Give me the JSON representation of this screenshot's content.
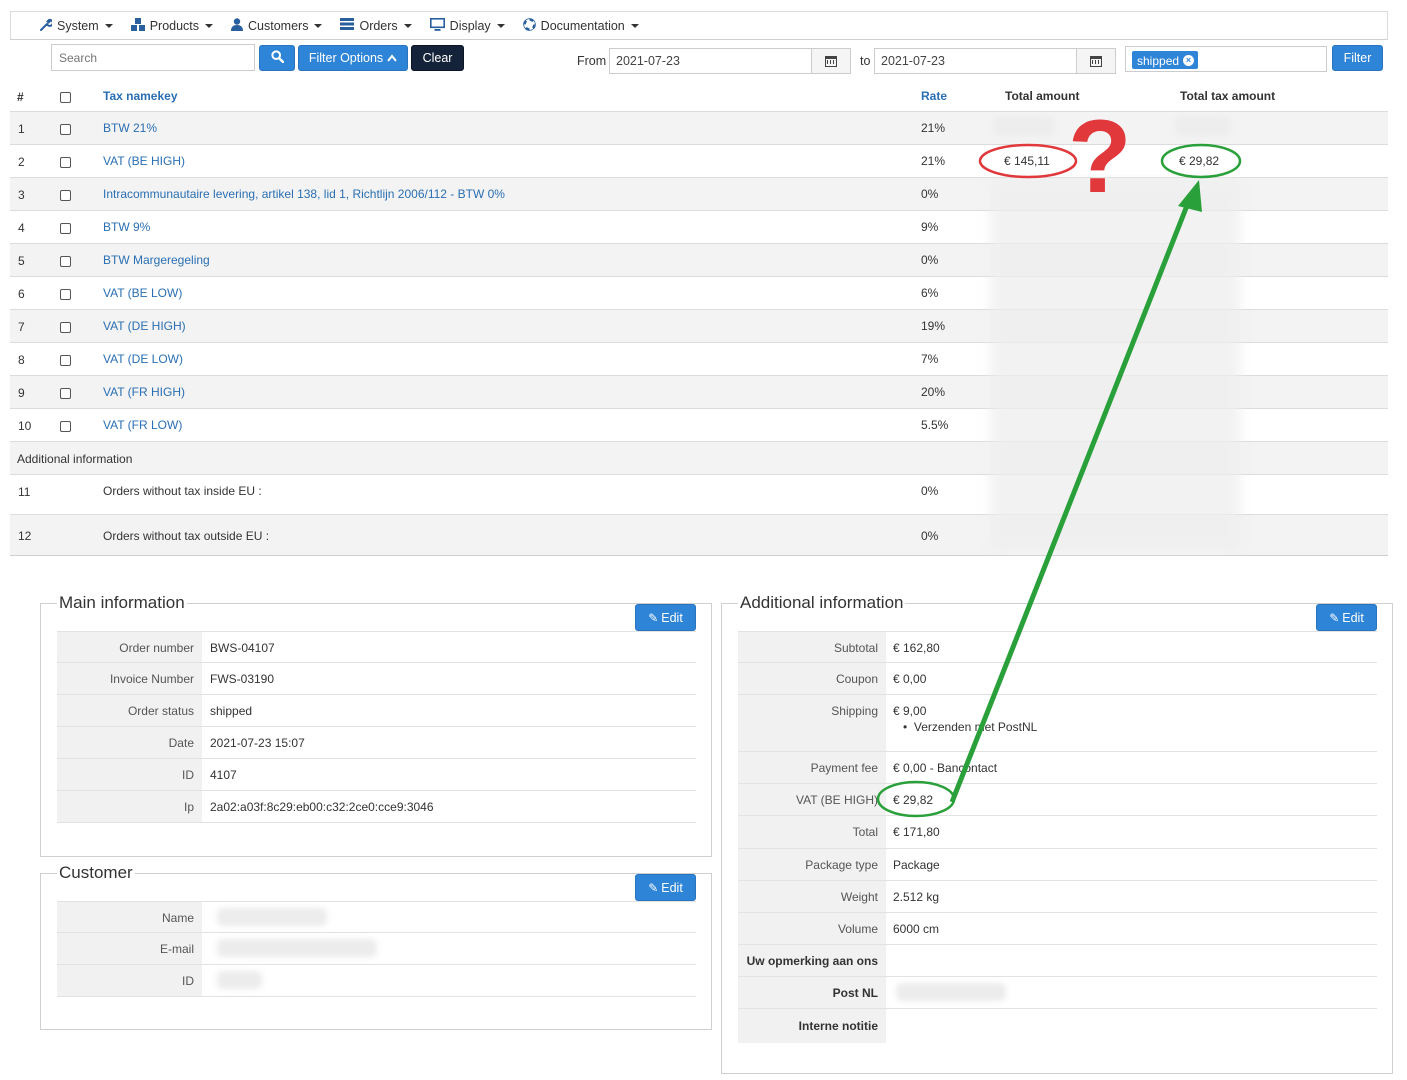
{
  "nav": {
    "items": [
      {
        "label": "System"
      },
      {
        "label": "Products"
      },
      {
        "label": "Customers"
      },
      {
        "label": "Orders"
      },
      {
        "label": "Display"
      },
      {
        "label": "Documentation"
      }
    ]
  },
  "filters": {
    "search_placeholder": "Search",
    "filter_options_label": "Filter Options",
    "clear_label": "Clear",
    "from_label": "From",
    "from_value": "2021-07-23",
    "to_label": "to",
    "to_value": "2021-07-23",
    "status_tag": "shipped",
    "filter_label": "Filter"
  },
  "table": {
    "headers": {
      "num": "#",
      "namekey": "Tax namekey",
      "rate": "Rate",
      "total": "Total amount",
      "tax": "Total tax amount"
    },
    "rows": [
      {
        "num": "1",
        "name": "BTW 21%",
        "rate": "21%",
        "total": "",
        "tax": ""
      },
      {
        "num": "2",
        "name": "VAT (BE HIGH)",
        "rate": "21%",
        "total": "€ 145,11",
        "tax": "€ 29,82"
      },
      {
        "num": "3",
        "name": "Intracommunautaire levering, artikel 138, lid 1, Richtlijn 2006/112 - BTW 0%",
        "rate": "0%",
        "total": "",
        "tax": ""
      },
      {
        "num": "4",
        "name": "BTW 9%",
        "rate": "9%",
        "total": "",
        "tax": ""
      },
      {
        "num": "5",
        "name": "BTW Margeregeling",
        "rate": "0%",
        "total": "",
        "tax": ""
      },
      {
        "num": "6",
        "name": "VAT (BE LOW)",
        "rate": "6%",
        "total": "",
        "tax": ""
      },
      {
        "num": "7",
        "name": "VAT (DE HIGH)",
        "rate": "19%",
        "total": "",
        "tax": ""
      },
      {
        "num": "8",
        "name": "VAT (DE LOW)",
        "rate": "7%",
        "total": "",
        "tax": ""
      },
      {
        "num": "9",
        "name": "VAT (FR HIGH)",
        "rate": "20%",
        "total": "",
        "tax": ""
      },
      {
        "num": "10",
        "name": "VAT (FR LOW)",
        "rate": "5.5%",
        "total": "",
        "tax": ""
      }
    ],
    "additional_label": "Additional information",
    "extra_rows": [
      {
        "num": "11",
        "name": "Orders without tax inside EU :",
        "rate": "0%"
      },
      {
        "num": "12",
        "name": "Orders without tax outside EU :",
        "rate": "0%"
      }
    ]
  },
  "main_info": {
    "title": "Main information",
    "edit_label": "Edit",
    "fields": [
      {
        "key": "Order number",
        "value": "BWS-04107"
      },
      {
        "key": "Invoice Number",
        "value": "FWS-03190"
      },
      {
        "key": "Order status",
        "value": "shipped"
      },
      {
        "key": "Date",
        "value": "2021-07-23 15:07"
      },
      {
        "key": "ID",
        "value": "4107"
      },
      {
        "key": "Ip",
        "value": "2a02:a03f:8c29:eb00:c32:2ce0:cce9:3046"
      }
    ]
  },
  "customer": {
    "title": "Customer",
    "edit_label": "Edit",
    "fields": [
      {
        "key": "Name",
        "value": ""
      },
      {
        "key": "E-mail",
        "value": ""
      },
      {
        "key": "ID",
        "value": ""
      }
    ]
  },
  "additional_info": {
    "title": "Additional information",
    "edit_label": "Edit",
    "fields": [
      {
        "key": "Subtotal",
        "value": "€ 162,80"
      },
      {
        "key": "Coupon",
        "value": "€ 0,00"
      },
      {
        "key": "Shipping",
        "value": "€ 9,00",
        "sub": "Verzenden met PostNL"
      },
      {
        "key": "Payment fee",
        "value": "€ 0,00 - Bancontact"
      },
      {
        "key": "VAT (BE HIGH)",
        "value": "€ 29,82"
      },
      {
        "key": "Total",
        "value": "€ 171,80"
      },
      {
        "key": "Package type",
        "value": "Package"
      },
      {
        "key": "Weight",
        "value": "2.512 kg"
      },
      {
        "key": "Volume",
        "value": "6000 cm"
      },
      {
        "key": "Uw opmerking aan ons",
        "value": ""
      },
      {
        "key": "Post NL",
        "value": ""
      },
      {
        "key": "Interne notitie",
        "value": ""
      }
    ]
  },
  "annotation": {
    "question_mark": "?",
    "red": "#e0383b",
    "green": "#2aa03a"
  }
}
